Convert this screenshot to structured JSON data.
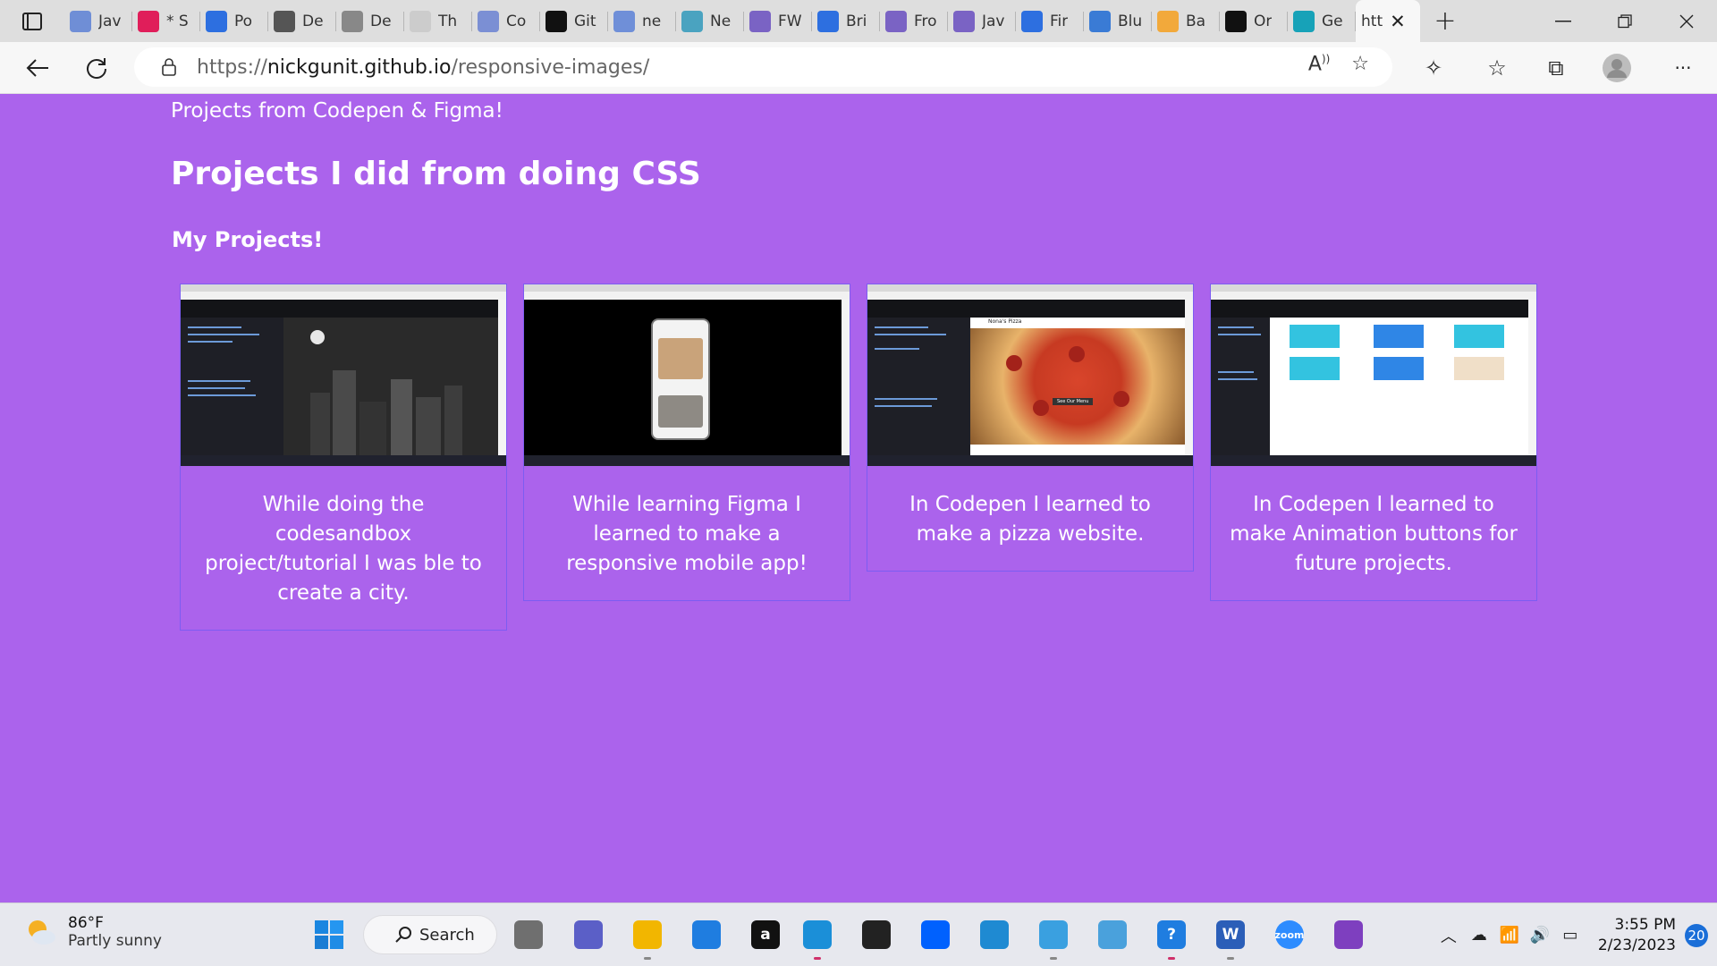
{
  "browser": {
    "tabs": [
      {
        "label": "Jav",
        "icon": "docs-icon",
        "color": "#6f8ed6"
      },
      {
        "label": "* S",
        "icon": "slack-icon",
        "color": "#e01e5a"
      },
      {
        "label": "Po",
        "icon": "docs-icon",
        "color": "#2d6fe0"
      },
      {
        "label": "De",
        "icon": "page-icon",
        "color": "#555555"
      },
      {
        "label": "De",
        "icon": "page-icon",
        "color": "#888888"
      },
      {
        "label": "Th",
        "icon": "blank-icon",
        "color": "#cccccc"
      },
      {
        "label": "Co",
        "icon": "docs-icon",
        "color": "#7b8fd4"
      },
      {
        "label": "Git",
        "icon": "github-icon",
        "color": "#111111"
      },
      {
        "label": "ne",
        "icon": "search-icon",
        "color": "#6f8fd8"
      },
      {
        "label": "Ne",
        "icon": "diamond-icon",
        "color": "#4aa3c0"
      },
      {
        "label": "FW",
        "icon": "list-icon",
        "color": "#7a63c4"
      },
      {
        "label": "Bri",
        "icon": "docs-icon",
        "color": "#2d6fe0"
      },
      {
        "label": "Fro",
        "icon": "list-icon",
        "color": "#7a63c4"
      },
      {
        "label": "Jav",
        "icon": "list-icon",
        "color": "#7a63c4"
      },
      {
        "label": "Fir",
        "icon": "docs-icon",
        "color": "#2d6fe0"
      },
      {
        "label": "Blu",
        "icon": "c-icon",
        "color": "#3a7bd5"
      },
      {
        "label": "Ba",
        "icon": "image-icon",
        "color": "#f2a93b"
      },
      {
        "label": "Or",
        "icon": "codepen-icon",
        "color": "#111111"
      },
      {
        "label": "Ge",
        "icon": "diamond-icon",
        "color": "#17a2b8"
      }
    ],
    "active_tab": {
      "label": "htt",
      "close": "✕"
    },
    "new_tab": "+",
    "url": {
      "protocol": "https://",
      "host": "nickgunit.github.io",
      "path": "/responsive-images/"
    }
  },
  "page": {
    "background": "#ab63ec",
    "sub_heading": "Projects from Codepen & Figma!",
    "heading": "Projects I did from doing CSS",
    "section_heading": "My Projects!",
    "cards": [
      {
        "caption": "While doing the codesandbox project/tutorial I was ble to create a city.",
        "shot": "city"
      },
      {
        "caption": "While learning Figma I learned to make a responsive mobile app!",
        "shot": "figma"
      },
      {
        "caption": "In Codepen I learned to make a pizza website.",
        "shot": "pizza",
        "shot_title": "Nona's Pizza",
        "shot_button": "See Our Menu"
      },
      {
        "caption": "In Codepen I learned to make Animation buttons for future projects.",
        "shot": "boxes"
      }
    ]
  },
  "taskbar": {
    "weather": {
      "temp": "86°F",
      "condition": "Partly sunny"
    },
    "search_label": "Search",
    "apps": [
      {
        "name": "task-view-icon",
        "color": "#6f6f6f"
      },
      {
        "name": "teams-chat-icon",
        "color": "#5b5fc7"
      },
      {
        "name": "file-explorer-icon",
        "color": "#f2b600"
      },
      {
        "name": "mail-icon",
        "color": "#1f7de0"
      },
      {
        "name": "amazon-icon",
        "color": "#111111",
        "glyph": "a"
      },
      {
        "name": "edge-icon",
        "color": "#1b8fd8"
      },
      {
        "name": "chatgpt-icon",
        "color": "#222222"
      },
      {
        "name": "dropbox-icon",
        "color": "#0061fe"
      },
      {
        "name": "vscode-icon",
        "color": "#1f8ad2"
      },
      {
        "name": "notepad-icon",
        "color": "#3aa0e0"
      },
      {
        "name": "photos-icon",
        "color": "#4aa1dc"
      },
      {
        "name": "help-icon",
        "color": "#1f7de0",
        "glyph": "?"
      },
      {
        "name": "word-icon",
        "color": "#2b5eb8",
        "glyph": "W"
      },
      {
        "name": "zoom-icon",
        "color": "#2d8cff",
        "glyph": "zoom"
      },
      {
        "name": "github-desktop-icon",
        "color": "#7e3fbf"
      }
    ],
    "time": "3:55 PM",
    "date": "2/23/2023",
    "notifications": "20"
  }
}
